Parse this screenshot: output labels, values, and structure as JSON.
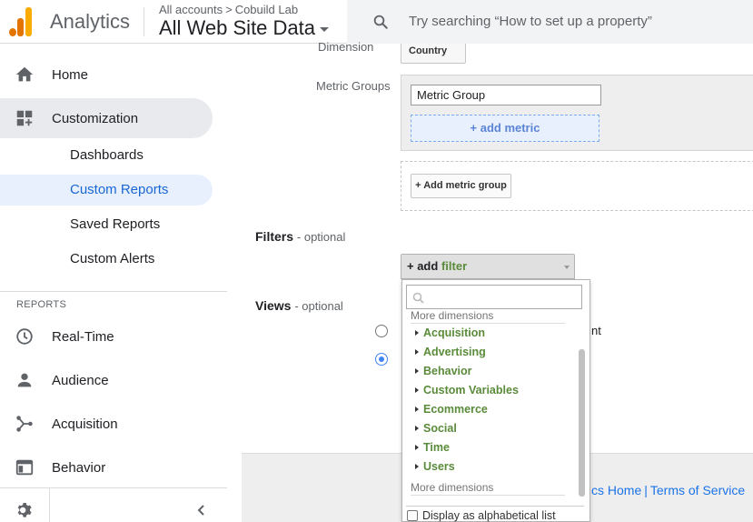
{
  "header": {
    "app_title": "Analytics",
    "breadcrumb": {
      "account": "All accounts",
      "separator": ">",
      "property": "Cobuild Lab"
    },
    "view_name": "All Web Site Data",
    "search_placeholder": "Try searching “How to set up a property”"
  },
  "sidebar": {
    "home": "Home",
    "customization": "Customization",
    "sub_items": [
      "Dashboards",
      "Custom Reports",
      "Saved Reports",
      "Custom Alerts"
    ],
    "reports_label": "REPORTS",
    "reports": [
      "Real-Time",
      "Audience",
      "Acquisition",
      "Behavior"
    ]
  },
  "form": {
    "dimension_label": "Dimension",
    "dimension_value": "Country",
    "metric_groups_label": "Metric Groups",
    "metric_group_value": "Metric Group",
    "add_metric": "+ add metric",
    "add_metric_group": "+ Add metric group",
    "filters_title": "Filters",
    "optional": "- optional",
    "add_filter_plus": "+ add",
    "add_filter_word": "filter",
    "views_title": "Views",
    "views_option_partial": "nt"
  },
  "dropdown": {
    "header_top": "More dimensions",
    "items": [
      "Acquisition",
      "Advertising",
      "Behavior",
      "Custom Variables",
      "Ecommerce",
      "Social",
      "Time",
      "Users"
    ],
    "header_bottom": "More dimensions",
    "alphabetical_label": "Display as alphabetical list"
  },
  "footer": {
    "home_link": "cs Home",
    "separator": "|",
    "terms_link": "Terms of Service"
  },
  "colors": {
    "accent_blue": "#1967d2",
    "dimension_green": "#5a8b3a",
    "logo_orange": "#f9ab00",
    "logo_dark_orange": "#e37400"
  }
}
